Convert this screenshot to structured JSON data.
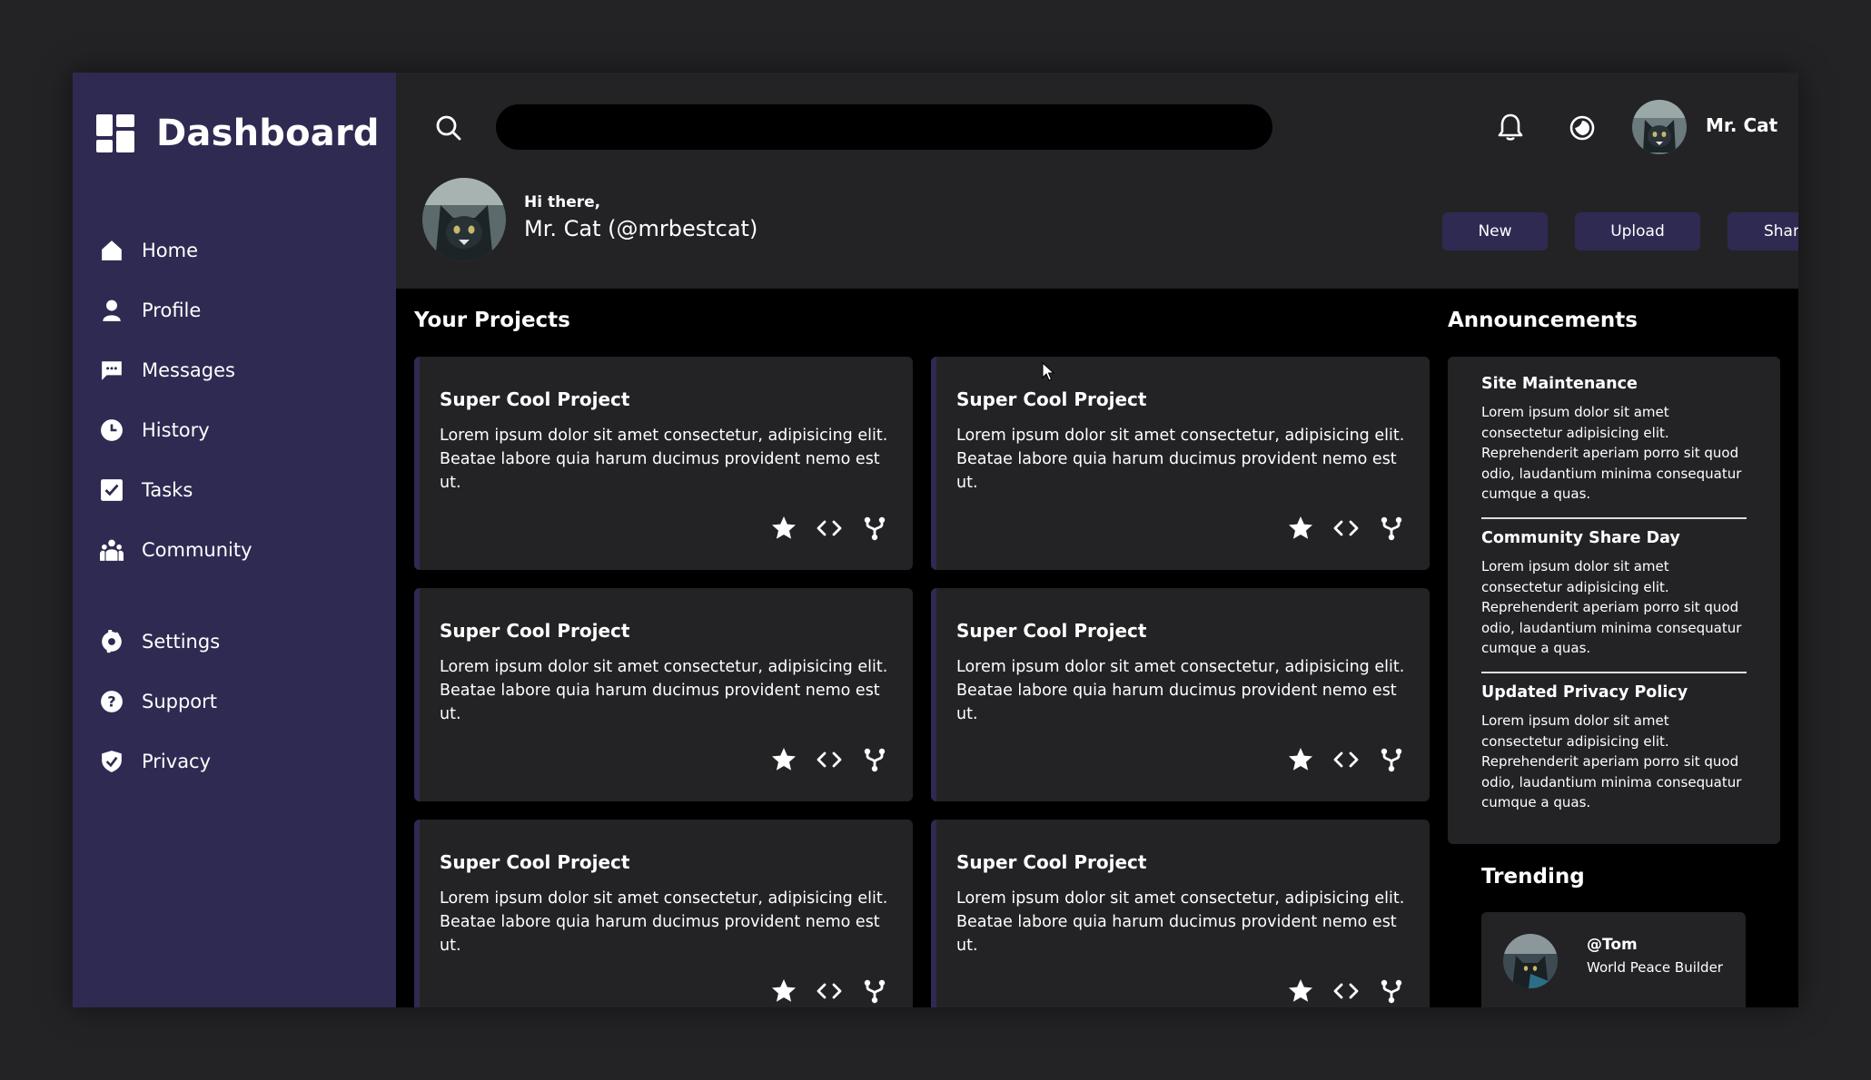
{
  "sidebar": {
    "brand": "Dashboard",
    "items": [
      {
        "label": "Home",
        "icon": "home-icon"
      },
      {
        "label": "Profile",
        "icon": "user-icon"
      },
      {
        "label": "Messages",
        "icon": "message-icon"
      },
      {
        "label": "History",
        "icon": "clock-icon"
      },
      {
        "label": "Tasks",
        "icon": "checkbox-icon"
      },
      {
        "label": "Community",
        "icon": "community-icon"
      },
      {
        "label": "Settings",
        "icon": "gear-icon"
      },
      {
        "label": "Support",
        "icon": "help-icon"
      },
      {
        "label": "Privacy",
        "icon": "shield-icon"
      }
    ]
  },
  "header": {
    "search_placeholder": "",
    "user_name": "Mr. Cat",
    "greeting": "Hi there,",
    "handle": "Mr. Cat (@mrbestcat)",
    "buttons": {
      "new": "New",
      "upload": "Upload",
      "share": "Share"
    }
  },
  "projects": {
    "title": "Your Projects",
    "items": [
      {
        "title": "Super Cool Project",
        "body": "Lorem ipsum dolor sit amet consectetur, adipisicing elit. Beatae labore quia harum ducimus provident nemo est ut."
      },
      {
        "title": "Super Cool Project",
        "body": "Lorem ipsum dolor sit amet consectetur, adipisicing elit. Beatae labore quia harum ducimus provident nemo est ut."
      },
      {
        "title": "Super Cool Project",
        "body": "Lorem ipsum dolor sit amet consectetur, adipisicing elit. Beatae labore quia harum ducimus provident nemo est ut."
      },
      {
        "title": "Super Cool Project",
        "body": "Lorem ipsum dolor sit amet consectetur, adipisicing elit. Beatae labore quia harum ducimus provident nemo est ut."
      },
      {
        "title": "Super Cool Project",
        "body": "Lorem ipsum dolor sit amet consectetur, adipisicing elit. Beatae labore quia harum ducimus provident nemo est ut."
      },
      {
        "title": "Super Cool Project",
        "body": "Lorem ipsum dolor sit amet consectetur, adipisicing elit. Beatae labore quia harum ducimus provident nemo est ut."
      }
    ]
  },
  "announcements": {
    "title": "Announcements",
    "items": [
      {
        "title": "Site Maintenance",
        "body": "Lorem ipsum dolor sit amet consectetur adipisicing elit. Reprehenderit aperiam porro sit quod odio, laudantium minima consequatur cumque a quas."
      },
      {
        "title": "Community Share Day",
        "body": "Lorem ipsum dolor sit amet consectetur adipisicing elit. Reprehenderit aperiam porro sit quod odio, laudantium minima consequatur cumque a quas."
      },
      {
        "title": "Updated Privacy Policy",
        "body": "Lorem ipsum dolor sit amet consectetur adipisicing elit. Reprehenderit aperiam porro sit quod odio, laudantium minima consequatur cumque a quas."
      }
    ]
  },
  "trending": {
    "title": "Trending",
    "items": [
      {
        "handle": "@Tom",
        "desc": "World Peace Builder"
      }
    ]
  },
  "colors": {
    "sidebar": "#2e2a52",
    "card": "#232325",
    "background": "#000000",
    "outer": "#232325"
  }
}
